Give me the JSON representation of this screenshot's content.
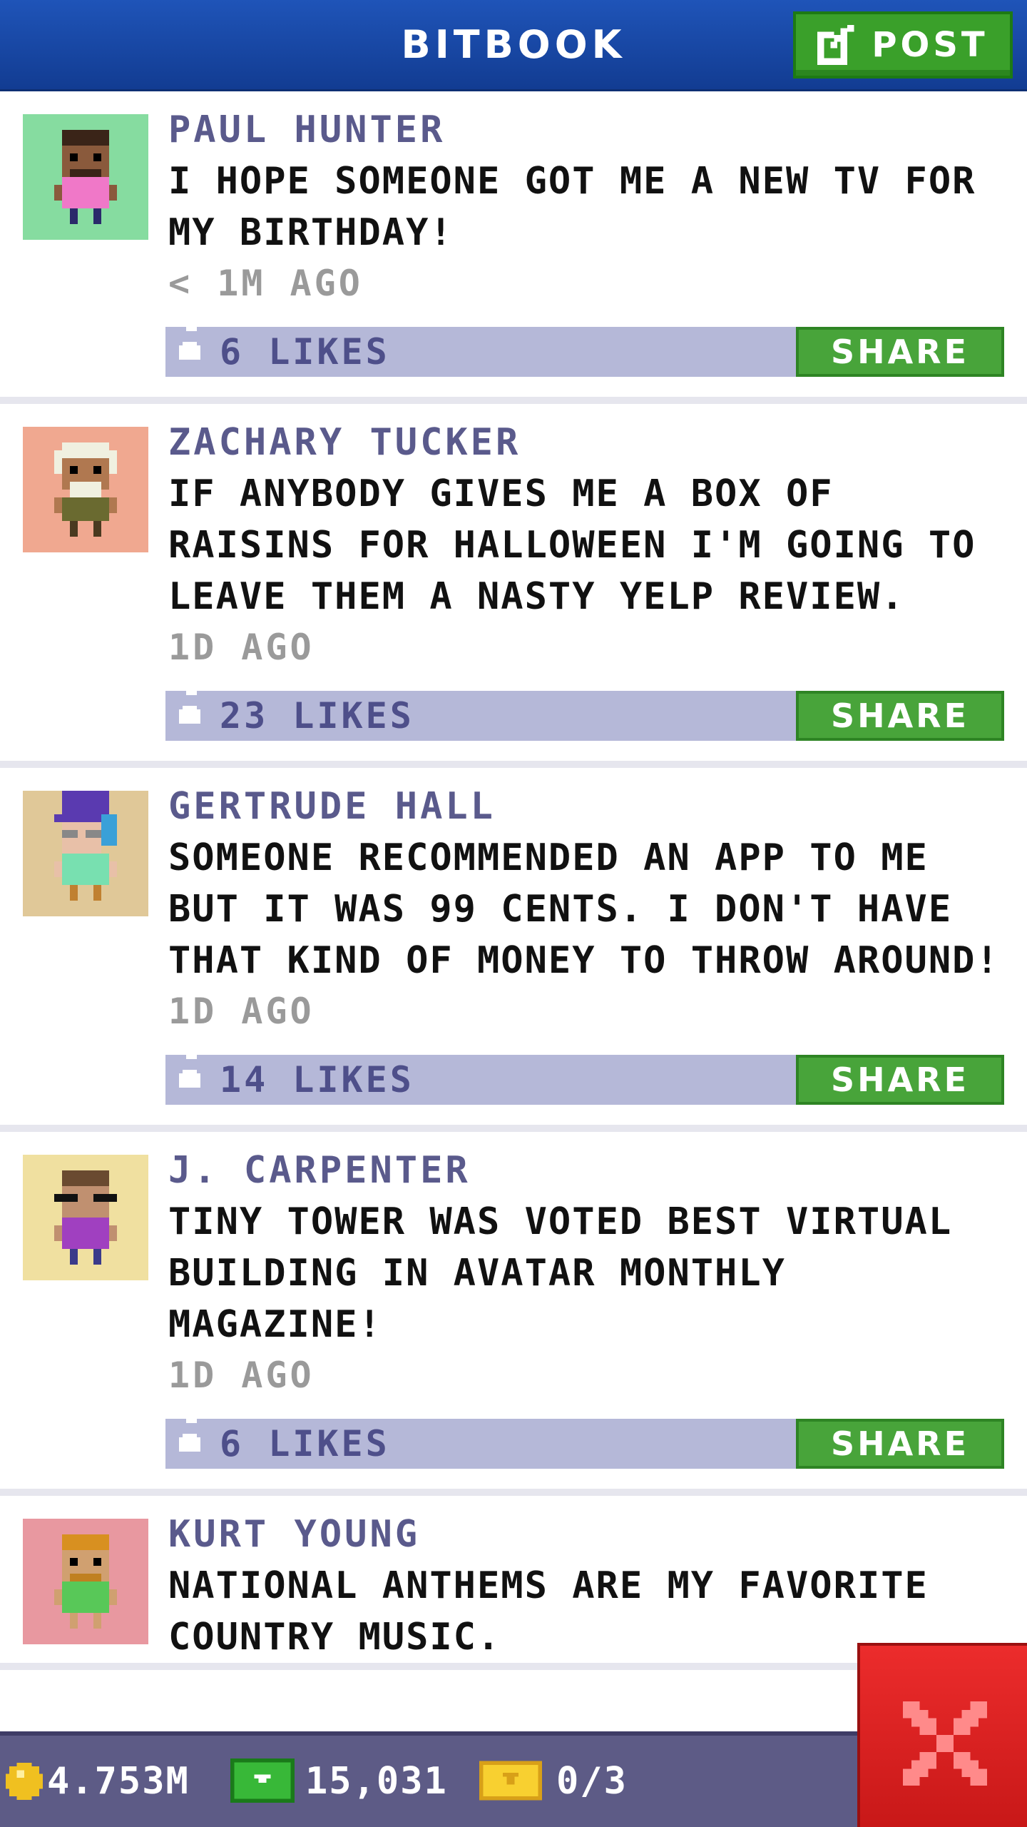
{
  "header": {
    "title": "BITBOOK",
    "post_button": {
      "label": "POST",
      "icon": "compose-icon"
    }
  },
  "posts": [
    {
      "author": "PAUL HUNTER",
      "message": "I HOPE SOMEONE GOT ME A NEW TV FOR MY BIRTHDAY!",
      "time": "< 1M AGO",
      "likes": "6 LIKES",
      "share": "SHARE",
      "avatar_bg": "#86dca0"
    },
    {
      "author": "ZACHARY TUCKER",
      "message": "IF ANYBODY GIVES ME A BOX OF RAISINS FOR HALLOWEEN I'M GOING TO LEAVE THEM A NASTY YELP REVIEW.",
      "time": "1D AGO",
      "likes": "23 LIKES",
      "share": "SHARE",
      "avatar_bg": "#f0a890"
    },
    {
      "author": "GERTRUDE HALL",
      "message": "SOMEONE RECOMMENDED AN APP TO ME BUT IT WAS 99 CENTS. I DON'T HAVE THAT KIND OF MONEY TO THROW AROUND!",
      "time": "1D AGO",
      "likes": "14 LIKES",
      "share": "SHARE",
      "avatar_bg": "#e0c898"
    },
    {
      "author": "J. CARPENTER",
      "message": "TINY TOWER WAS VOTED BEST VIRTUAL BUILDING IN AVATAR MONTHLY MAGAZINE!",
      "time": "1D AGO",
      "likes": "6 LIKES",
      "share": "SHARE",
      "avatar_bg": "#f0e0a0"
    },
    {
      "author": "KURT YOUNG",
      "message": "NATIONAL ANTHEMS ARE MY FAVORITE COUNTRY MUSIC.",
      "avatar_bg": "#e898a0"
    }
  ],
  "status_bar": {
    "coins": "4.753M",
    "bux": "15,031",
    "tickets": "0/3"
  },
  "close_button": {
    "icon": "close-icon"
  },
  "colors": {
    "header": "#1f54b8",
    "accent_green": "#3aa02a",
    "likes_bar": "#b5b8d8",
    "author_name": "#5a5a8c",
    "status_bar": "#5d5b86",
    "close_red": "#e02222"
  }
}
